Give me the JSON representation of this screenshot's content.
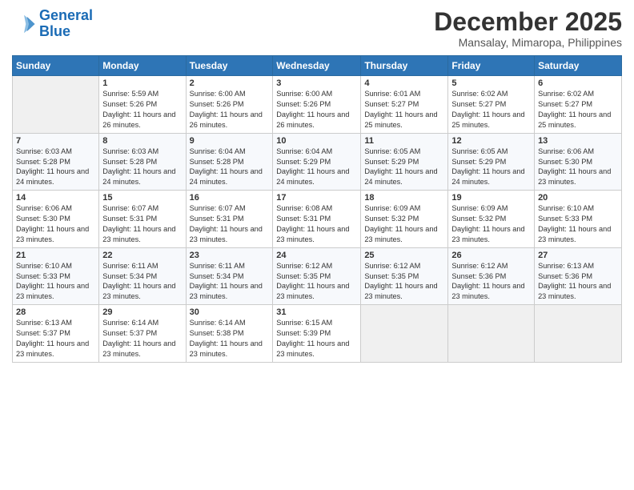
{
  "logo": {
    "line1": "General",
    "line2": "Blue"
  },
  "title": "December 2025",
  "location": "Mansalay, Mimaropa, Philippines",
  "days_header": [
    "Sunday",
    "Monday",
    "Tuesday",
    "Wednesday",
    "Thursday",
    "Friday",
    "Saturday"
  ],
  "weeks": [
    [
      {
        "day": "",
        "sunrise": "",
        "sunset": "",
        "daylight": ""
      },
      {
        "day": "1",
        "sunrise": "Sunrise: 5:59 AM",
        "sunset": "Sunset: 5:26 PM",
        "daylight": "Daylight: 11 hours and 26 minutes."
      },
      {
        "day": "2",
        "sunrise": "Sunrise: 6:00 AM",
        "sunset": "Sunset: 5:26 PM",
        "daylight": "Daylight: 11 hours and 26 minutes."
      },
      {
        "day": "3",
        "sunrise": "Sunrise: 6:00 AM",
        "sunset": "Sunset: 5:26 PM",
        "daylight": "Daylight: 11 hours and 26 minutes."
      },
      {
        "day": "4",
        "sunrise": "Sunrise: 6:01 AM",
        "sunset": "Sunset: 5:27 PM",
        "daylight": "Daylight: 11 hours and 25 minutes."
      },
      {
        "day": "5",
        "sunrise": "Sunrise: 6:02 AM",
        "sunset": "Sunset: 5:27 PM",
        "daylight": "Daylight: 11 hours and 25 minutes."
      },
      {
        "day": "6",
        "sunrise": "Sunrise: 6:02 AM",
        "sunset": "Sunset: 5:27 PM",
        "daylight": "Daylight: 11 hours and 25 minutes."
      }
    ],
    [
      {
        "day": "7",
        "sunrise": "Sunrise: 6:03 AM",
        "sunset": "Sunset: 5:28 PM",
        "daylight": "Daylight: 11 hours and 24 minutes."
      },
      {
        "day": "8",
        "sunrise": "Sunrise: 6:03 AM",
        "sunset": "Sunset: 5:28 PM",
        "daylight": "Daylight: 11 hours and 24 minutes."
      },
      {
        "day": "9",
        "sunrise": "Sunrise: 6:04 AM",
        "sunset": "Sunset: 5:28 PM",
        "daylight": "Daylight: 11 hours and 24 minutes."
      },
      {
        "day": "10",
        "sunrise": "Sunrise: 6:04 AM",
        "sunset": "Sunset: 5:29 PM",
        "daylight": "Daylight: 11 hours and 24 minutes."
      },
      {
        "day": "11",
        "sunrise": "Sunrise: 6:05 AM",
        "sunset": "Sunset: 5:29 PM",
        "daylight": "Daylight: 11 hours and 24 minutes."
      },
      {
        "day": "12",
        "sunrise": "Sunrise: 6:05 AM",
        "sunset": "Sunset: 5:29 PM",
        "daylight": "Daylight: 11 hours and 24 minutes."
      },
      {
        "day": "13",
        "sunrise": "Sunrise: 6:06 AM",
        "sunset": "Sunset: 5:30 PM",
        "daylight": "Daylight: 11 hours and 23 minutes."
      }
    ],
    [
      {
        "day": "14",
        "sunrise": "Sunrise: 6:06 AM",
        "sunset": "Sunset: 5:30 PM",
        "daylight": "Daylight: 11 hours and 23 minutes."
      },
      {
        "day": "15",
        "sunrise": "Sunrise: 6:07 AM",
        "sunset": "Sunset: 5:31 PM",
        "daylight": "Daylight: 11 hours and 23 minutes."
      },
      {
        "day": "16",
        "sunrise": "Sunrise: 6:07 AM",
        "sunset": "Sunset: 5:31 PM",
        "daylight": "Daylight: 11 hours and 23 minutes."
      },
      {
        "day": "17",
        "sunrise": "Sunrise: 6:08 AM",
        "sunset": "Sunset: 5:31 PM",
        "daylight": "Daylight: 11 hours and 23 minutes."
      },
      {
        "day": "18",
        "sunrise": "Sunrise: 6:09 AM",
        "sunset": "Sunset: 5:32 PM",
        "daylight": "Daylight: 11 hours and 23 minutes."
      },
      {
        "day": "19",
        "sunrise": "Sunrise: 6:09 AM",
        "sunset": "Sunset: 5:32 PM",
        "daylight": "Daylight: 11 hours and 23 minutes."
      },
      {
        "day": "20",
        "sunrise": "Sunrise: 6:10 AM",
        "sunset": "Sunset: 5:33 PM",
        "daylight": "Daylight: 11 hours and 23 minutes."
      }
    ],
    [
      {
        "day": "21",
        "sunrise": "Sunrise: 6:10 AM",
        "sunset": "Sunset: 5:33 PM",
        "daylight": "Daylight: 11 hours and 23 minutes."
      },
      {
        "day": "22",
        "sunrise": "Sunrise: 6:11 AM",
        "sunset": "Sunset: 5:34 PM",
        "daylight": "Daylight: 11 hours and 23 minutes."
      },
      {
        "day": "23",
        "sunrise": "Sunrise: 6:11 AM",
        "sunset": "Sunset: 5:34 PM",
        "daylight": "Daylight: 11 hours and 23 minutes."
      },
      {
        "day": "24",
        "sunrise": "Sunrise: 6:12 AM",
        "sunset": "Sunset: 5:35 PM",
        "daylight": "Daylight: 11 hours and 23 minutes."
      },
      {
        "day": "25",
        "sunrise": "Sunrise: 6:12 AM",
        "sunset": "Sunset: 5:35 PM",
        "daylight": "Daylight: 11 hours and 23 minutes."
      },
      {
        "day": "26",
        "sunrise": "Sunrise: 6:12 AM",
        "sunset": "Sunset: 5:36 PM",
        "daylight": "Daylight: 11 hours and 23 minutes."
      },
      {
        "day": "27",
        "sunrise": "Sunrise: 6:13 AM",
        "sunset": "Sunset: 5:36 PM",
        "daylight": "Daylight: 11 hours and 23 minutes."
      }
    ],
    [
      {
        "day": "28",
        "sunrise": "Sunrise: 6:13 AM",
        "sunset": "Sunset: 5:37 PM",
        "daylight": "Daylight: 11 hours and 23 minutes."
      },
      {
        "day": "29",
        "sunrise": "Sunrise: 6:14 AM",
        "sunset": "Sunset: 5:37 PM",
        "daylight": "Daylight: 11 hours and 23 minutes."
      },
      {
        "day": "30",
        "sunrise": "Sunrise: 6:14 AM",
        "sunset": "Sunset: 5:38 PM",
        "daylight": "Daylight: 11 hours and 23 minutes."
      },
      {
        "day": "31",
        "sunrise": "Sunrise: 6:15 AM",
        "sunset": "Sunset: 5:39 PM",
        "daylight": "Daylight: 11 hours and 23 minutes."
      },
      {
        "day": "",
        "sunrise": "",
        "sunset": "",
        "daylight": ""
      },
      {
        "day": "",
        "sunrise": "",
        "sunset": "",
        "daylight": ""
      },
      {
        "day": "",
        "sunrise": "",
        "sunset": "",
        "daylight": ""
      }
    ]
  ]
}
